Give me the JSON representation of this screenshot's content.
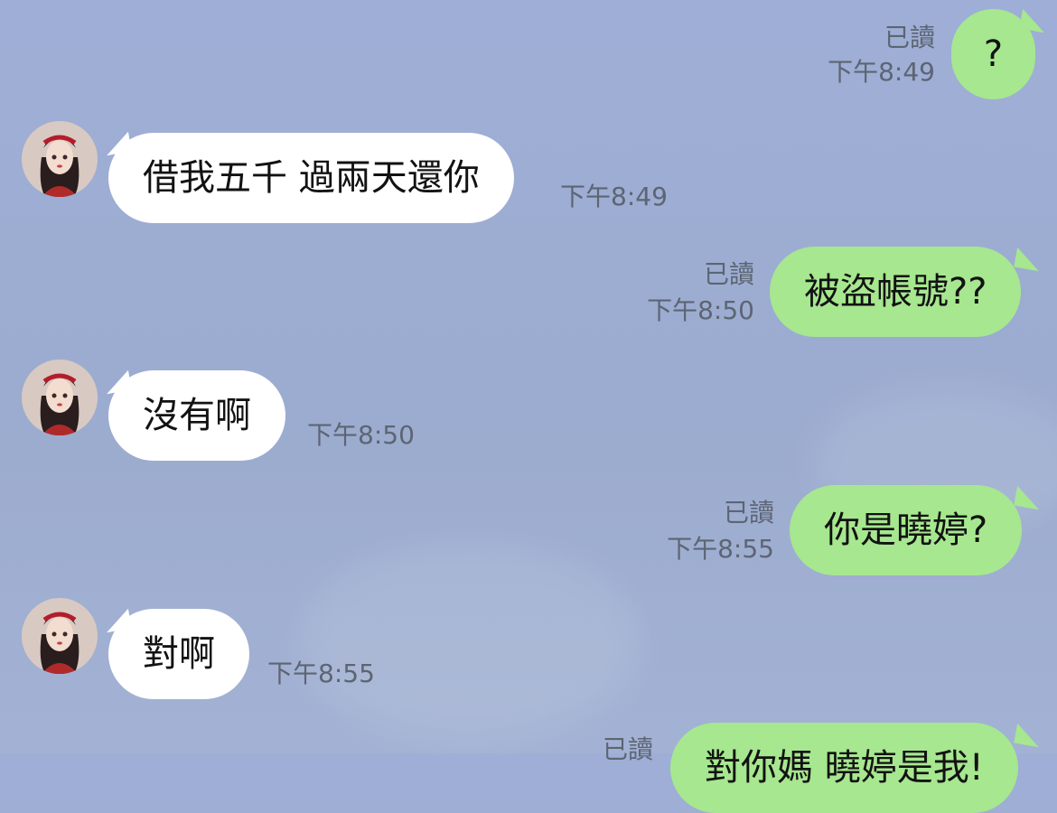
{
  "colors": {
    "background": "#9eaed6",
    "incoming_bubble": "#ffffff",
    "outgoing_bubble": "#a6e78f",
    "meta_text": "#5d6573"
  },
  "messages": [
    {
      "direction": "out",
      "text": "?",
      "read": "已讀",
      "time": "下午8:49"
    },
    {
      "direction": "in",
      "text": "借我五千 過兩天還你",
      "time": "下午8:49"
    },
    {
      "direction": "out",
      "text": "被盜帳號??",
      "read": "已讀",
      "time": "下午8:50"
    },
    {
      "direction": "in",
      "text": "沒有啊",
      "time": "下午8:50"
    },
    {
      "direction": "out",
      "text": "你是曉婷?",
      "read": "已讀",
      "time": "下午8:55"
    },
    {
      "direction": "in",
      "text": "對啊",
      "time": "下午8:55"
    },
    {
      "direction": "out",
      "text": "對你媽 曉婷是我!",
      "read": "已讀"
    }
  ]
}
